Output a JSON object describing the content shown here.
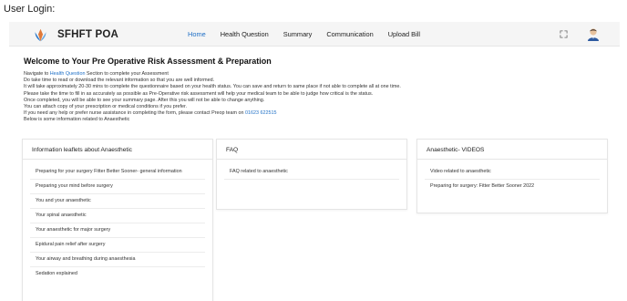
{
  "caption": "User Login:",
  "navbar": {
    "brand": "SFHFT POA",
    "items": [
      {
        "label": "Home",
        "active": true
      },
      {
        "label": "Health Question",
        "active": false
      },
      {
        "label": "Summary",
        "active": false
      },
      {
        "label": "Communication",
        "active": false
      },
      {
        "label": "Upload Bill",
        "active": false
      }
    ],
    "icons": {
      "fullscreen": "fullscreen-icon",
      "avatar": "user-avatar-icon"
    }
  },
  "main": {
    "title": "Welcome to Your Pre Operative Risk Assessment & Preparation",
    "intro": {
      "line1_prefix": "Navigate to ",
      "line1_link": "Health Question",
      "line1_suffix": " Section to complete your Assessment",
      "line2": "Do take time to read or download the relevant information so that you are well informed.",
      "line3": "It will take approximately 20-30 mins to complete the questionnaire based on your health status. You can save and return to same place if not able to complete all at one time.",
      "line4": "Please take the time to fill in as accurately as possible as Pre-Operative risk assessment will help your medical team to be able to judge how critical is the status.",
      "line5": "Once completed, you will be able to see your summary page. After this you will not be able to change anything.",
      "line6": "You can attach copy of your prescription or medical conditions if you prefer.",
      "line7_prefix": "If you need any help or prefer nurse assistance in completing the form, please contact Preop team on ",
      "line7_phone": "01623 622515",
      "line8": "Below is some information related to Anaesthetic"
    }
  },
  "cards": {
    "leaflets": {
      "title": "Information leaflets about Anaesthetic",
      "items": [
        "Preparing for your surgery Fitter Better Sooner- general information",
        "Preparing your mind before surgery",
        "You and your anaesthetic",
        "Your spinal anaesthetic",
        "Your anaesthetic for major surgery",
        "Epidural pain relief after surgery",
        "Your airway and breathing during anaesthesia",
        "Sedation explained"
      ]
    },
    "faq": {
      "title": "FAQ",
      "items": [
        "FAQ related to anaesthetic"
      ]
    },
    "videos": {
      "title": "Anaesthetic- VIDEOS",
      "items": [
        "Video related to anaesthetic",
        "Preparing for surgery: Fitter Better Sooner 2022"
      ]
    }
  },
  "colors": {
    "accent": "#1e6fc6",
    "navbar_bg": "#f5f5f5"
  }
}
